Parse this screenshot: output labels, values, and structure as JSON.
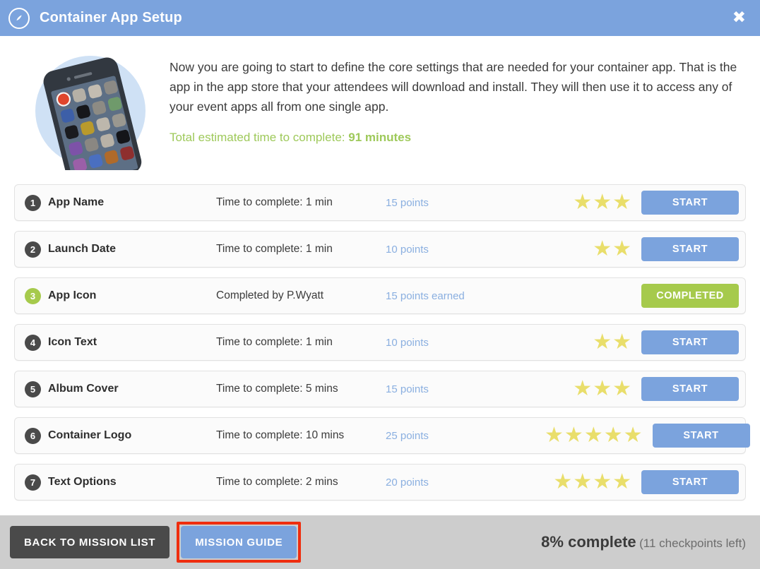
{
  "header": {
    "title": "Container App Setup",
    "icon": "compass-icon",
    "close_label": "✖",
    "bg_color": "#7ba3dd"
  },
  "intro": {
    "illustration": "smartphone-app-grid-illustration",
    "paragraph": "Now you are going to start to define the core settings that are needed for your container app. That is the app in the app store that your attendees will download and install. They will then use it to access any of your event apps all from one single app.",
    "time_label": "Total estimated time to complete:",
    "time_value": "91 minutes",
    "time_color": "#9ec95a"
  },
  "checkpoints": [
    {
      "number": "1",
      "title": "App Name",
      "time": "Time to complete: 1 min",
      "points": "15 points",
      "stars": 3,
      "action": "START",
      "state": "todo"
    },
    {
      "number": "2",
      "title": "Launch Date",
      "time": "Time to complete: 1 min",
      "points": "10 points",
      "stars": 2,
      "action": "START",
      "state": "todo"
    },
    {
      "number": "3",
      "title": "App Icon",
      "time": "Completed by P.Wyatt",
      "points": "15 points earned",
      "stars": 0,
      "action": "COMPLETED",
      "state": "completed"
    },
    {
      "number": "4",
      "title": "Icon Text",
      "time": "Time to complete: 1 min",
      "points": "10 points",
      "stars": 2,
      "action": "START",
      "state": "todo"
    },
    {
      "number": "5",
      "title": "Album Cover",
      "time": "Time to complete: 5 mins",
      "points": "15 points",
      "stars": 3,
      "action": "START",
      "state": "todo"
    },
    {
      "number": "6",
      "title": "Container Logo",
      "time": "Time to complete: 10 mins",
      "points": "25 points",
      "stars": 5,
      "action": "START",
      "state": "todo"
    },
    {
      "number": "7",
      "title": "Text Options",
      "time": "Time to complete: 2 mins",
      "points": "20 points",
      "stars": 4,
      "action": "START",
      "state": "todo"
    }
  ],
  "footer": {
    "back_label": "BACK TO MISSION LIST",
    "guide_label": "MISSION GUIDE",
    "guide_highlight_color": "#ef2d0e",
    "progress_pct": "8% complete",
    "progress_left": "(11 checkpoints left)"
  },
  "colors": {
    "accent_blue": "#7ba3dd",
    "accent_green": "#a6ca4c",
    "star_yellow": "#e9de6b",
    "points_blue": "#8aafe0"
  }
}
